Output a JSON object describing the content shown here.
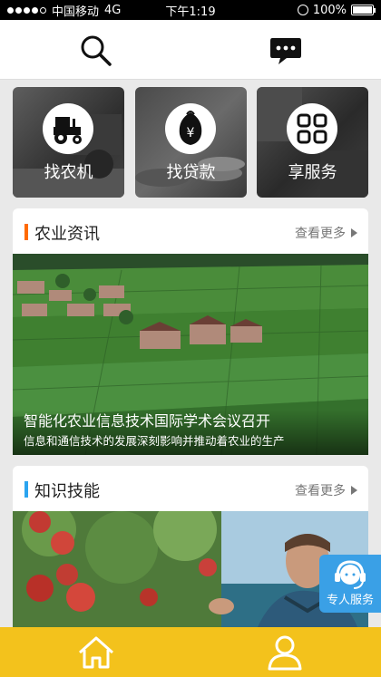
{
  "status_bar": {
    "carrier": "中国移动",
    "network": "4G",
    "time": "下午1:19",
    "battery_percent": "100%",
    "signal_bars_filled": 4,
    "signal_bars_total": 5
  },
  "header": {
    "search_icon": "search-icon",
    "message_icon": "chat-bubble-icon"
  },
  "shortcuts": [
    {
      "label": "找农机",
      "icon": "tractor-icon"
    },
    {
      "label": "找贷款",
      "icon": "yuan-coin-icon"
    },
    {
      "label": "享服务",
      "icon": "grid-icon"
    }
  ],
  "news_section": {
    "title": "农业资讯",
    "more_label": "查看更多",
    "accent_color": "#ff6a00",
    "article": {
      "title": "智能化农业信息技术国际学术会议召开",
      "subtitle": "信息和通信技术的发展深刻影响并推动着农业的生产"
    }
  },
  "skills_section": {
    "title": "知识技能",
    "more_label": "查看更多",
    "accent_color": "#2ba4f0"
  },
  "service_button": {
    "label": "专人服务",
    "icon": "headset-icon"
  },
  "tab_bar": {
    "color": "#f3c21c",
    "items": [
      {
        "icon": "home-icon"
      },
      {
        "icon": "user-icon"
      }
    ]
  }
}
